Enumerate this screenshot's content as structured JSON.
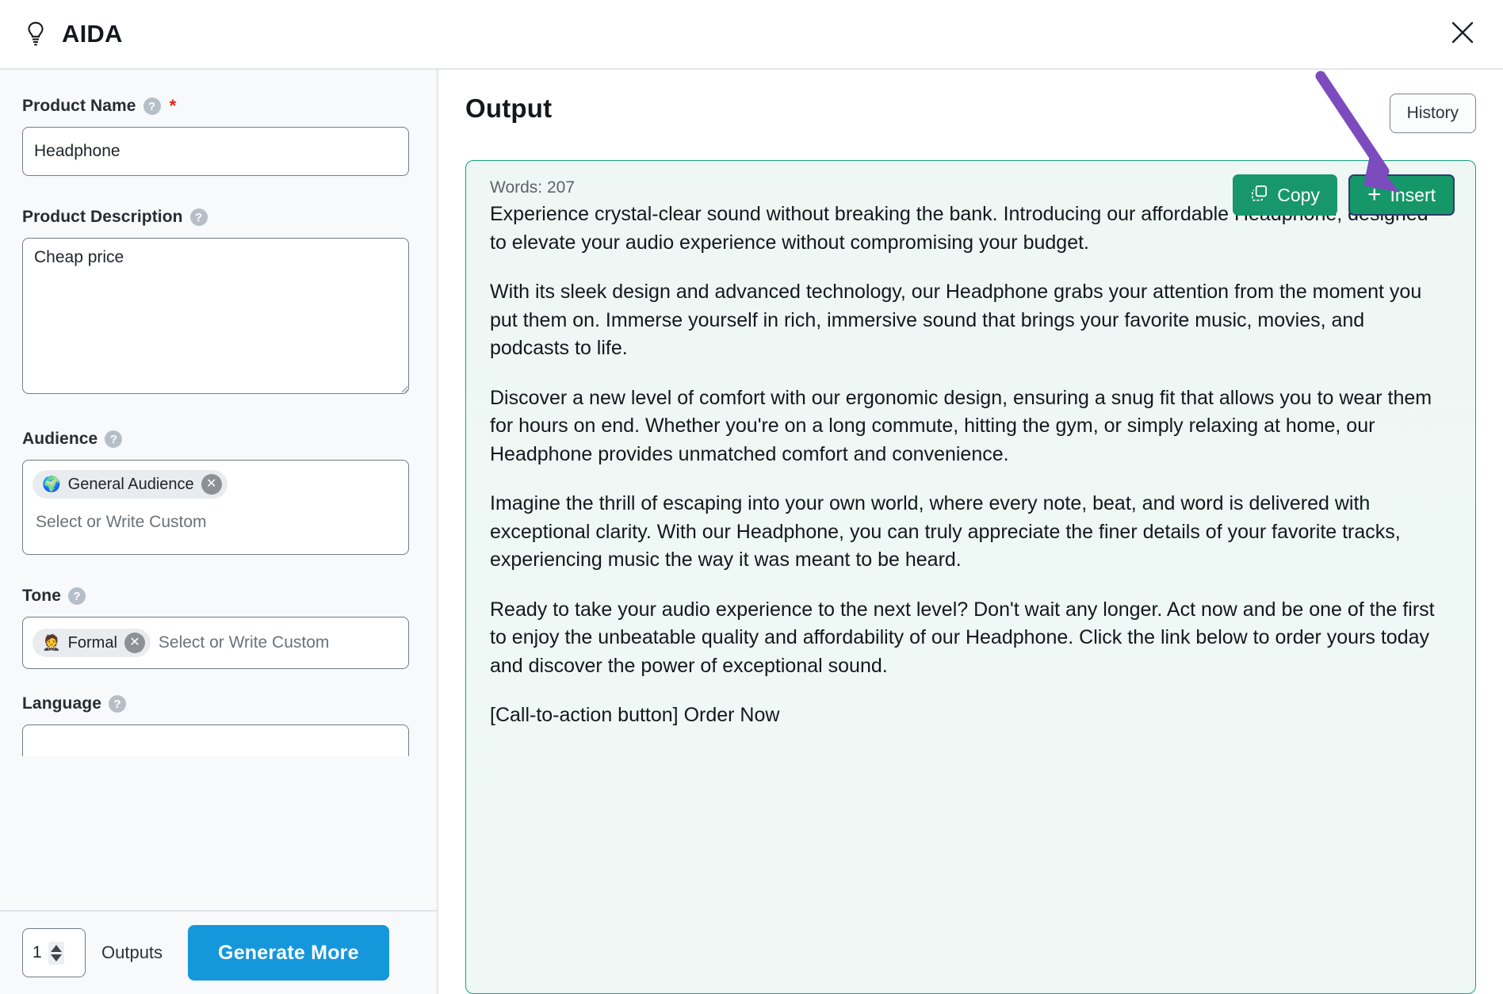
{
  "header": {
    "title": "AIDA",
    "bulb_icon": "lightbulb-icon",
    "close_icon": "close-icon"
  },
  "form": {
    "product_name": {
      "label": "Product Name",
      "help_icon": "?",
      "required_marker": "*",
      "value": "Headphone",
      "placeholder": ""
    },
    "product_description": {
      "label": "Product Description",
      "help_icon": "?",
      "value": "Cheap price",
      "placeholder": ""
    },
    "audience": {
      "label": "Audience",
      "help_icon": "?",
      "tags": [
        {
          "emoji": "🌍",
          "label": "General Audience",
          "remove_icon": "✕"
        }
      ],
      "placeholder": "Select or Write Custom"
    },
    "tone": {
      "label": "Tone",
      "help_icon": "?",
      "tags": [
        {
          "emoji": "🤵",
          "label": "Formal",
          "remove_icon": "✕"
        }
      ],
      "placeholder": "Select or Write Custom"
    },
    "language": {
      "label": "Language",
      "help_icon": "?"
    }
  },
  "footer": {
    "outputs_count": "1",
    "outputs_label": "Outputs",
    "generate_label": "Generate More",
    "generate_color": "#1597dc"
  },
  "output": {
    "title": "Output",
    "history_label": "History",
    "words_label": "Words: 207",
    "copy_label": "Copy",
    "copy_icon": "copy-icon",
    "insert_label": "Insert",
    "insert_icon": "plus-icon",
    "card_border_color": "#17a27c",
    "card_bg_color": "#eff7f3",
    "button_color": "#17976b",
    "paragraphs": [
      "Experience crystal-clear sound without breaking the bank. Introducing our affordable Headphone, designed to elevate your audio experience without compromising your budget.",
      "With its sleek design and advanced technology, our Headphone grabs your attention from the moment you put them on. Immerse yourself in rich, immersive sound that brings your favorite music, movies, and podcasts to life.",
      "Discover a new level of comfort with our ergonomic design, ensuring a snug fit that allows you to wear them for hours on end. Whether you're on a long commute, hitting the gym, or simply relaxing at home, our Headphone provides unmatched comfort and convenience.",
      "Imagine the thrill of escaping into your own world, where every note, beat, and word is delivered with exceptional clarity. With our Headphone, you can truly appreciate the finer details of your favorite tracks, experiencing music the way it was meant to be heard.",
      "Ready to take your audio experience to the next level? Don't wait any longer. Act now and be one of the first to enjoy the unbeatable quality and affordability of our Headphone. Click the link below to order yours today and discover the power of exceptional sound.",
      "[Call-to-action button] Order Now"
    ]
  },
  "annotation": {
    "arrow_color": "#7c4bbd",
    "arrow_target": "insert-button"
  }
}
